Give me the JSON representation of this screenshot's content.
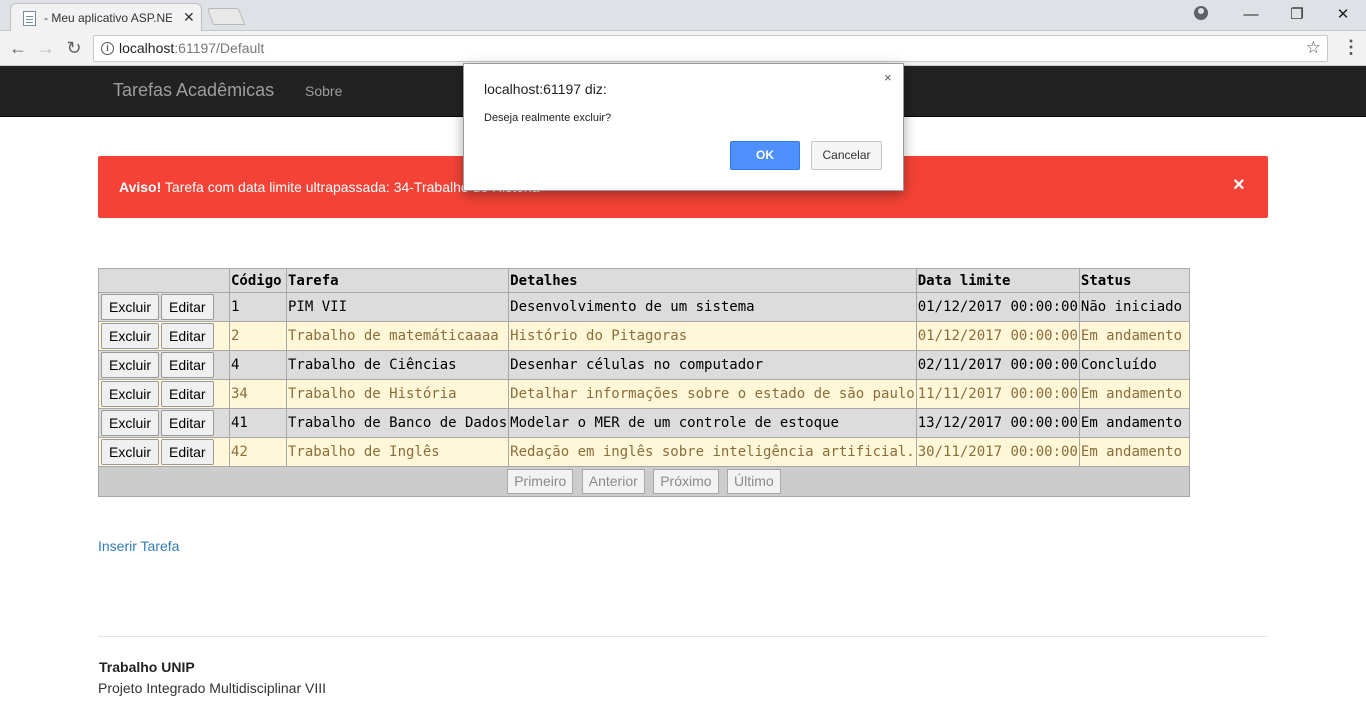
{
  "browser": {
    "tab_title": "- Meu aplicativo ASP.NET",
    "url_host": "localhost",
    "url_path": ":61197/Default"
  },
  "navbar": {
    "brand": "Tarefas Acadêmicas",
    "link_about": "Sobre"
  },
  "alert": {
    "strong": "Aviso!",
    "message": " Tarefa com data limite ultrapassada: 34-Trabalho de História",
    "close": "×"
  },
  "table": {
    "headers": [
      "",
      "Código",
      "Tarefa",
      "Detalhes",
      "Data limite",
      "Status"
    ],
    "delete_label": "Excluir",
    "edit_label": "Editar",
    "rows": [
      {
        "code": "1",
        "task": "PIM VII",
        "details": "Desenvolvimento de um sistema",
        "deadline": "01/12/2017 00:00:00",
        "status": "Não iniciado"
      },
      {
        "code": "2",
        "task": "Trabalho de matemáticaaaa",
        "details": "Histório do Pitagoras",
        "deadline": "01/12/2017 00:00:00",
        "status": "Em andamento"
      },
      {
        "code": "4",
        "task": "Trabalho de Ciências",
        "details": "Desenhar células no computador",
        "deadline": "02/11/2017 00:00:00",
        "status": "Concluído"
      },
      {
        "code": "34",
        "task": "Trabalho de História",
        "details": "Detalhar informações sobre o estado de são paulo",
        "deadline": "11/11/2017 00:00:00",
        "status": "Em andamento"
      },
      {
        "code": "41",
        "task": "Trabalho de Banco de Dados",
        "details": "Modelar o MER de um controle de estoque",
        "deadline": "13/12/2017 00:00:00",
        "status": "Em andamento"
      },
      {
        "code": "42",
        "task": "Trabalho de Inglês",
        "details": "Redação em inglês sobre inteligência artificial.",
        "deadline": "30/11/2017 00:00:00",
        "status": "Em andamento"
      }
    ],
    "pager": [
      "Primeiro",
      "Anterior",
      "Próximo",
      "Último"
    ]
  },
  "insert_link": "Inserir Tarefa",
  "footer": {
    "title": "Trabalho UNIP",
    "subtitle": "Projeto Integrado Multidisciplinar VIII"
  },
  "dialog": {
    "title": "localhost:61197 diz:",
    "message": "Deseja realmente excluir?",
    "ok": "OK",
    "cancel": "Cancelar",
    "close": "×"
  }
}
